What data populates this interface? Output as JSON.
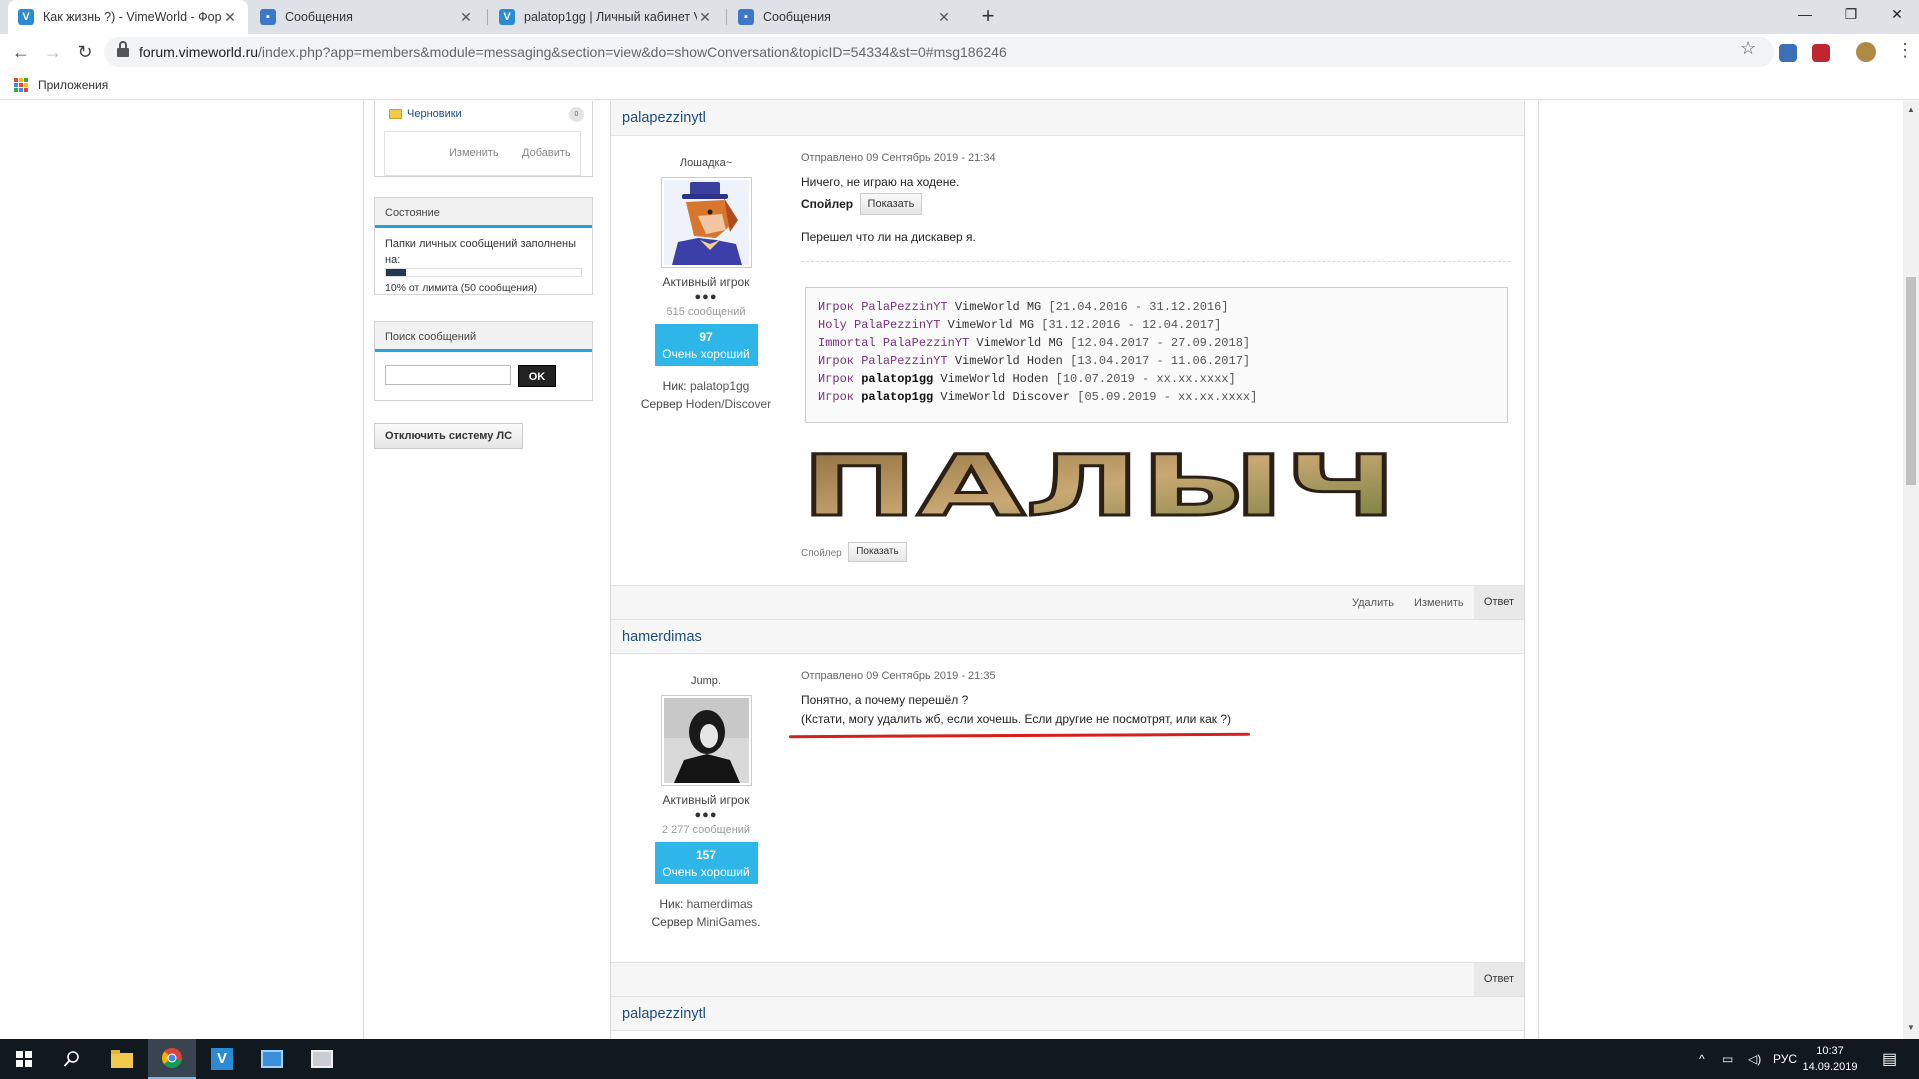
{
  "browser": {
    "tabs": [
      {
        "label": "Как жизнь ?) - VimeWorld - Фор",
        "icon": "vimeworld-icon",
        "active": true
      },
      {
        "label": "Сообщения",
        "icon": "messages-icon",
        "active": false
      },
      {
        "label": "palatop1gg | Личный кабинет V",
        "icon": "vimeworld-icon",
        "active": false
      },
      {
        "label": "Сообщения",
        "icon": "messages-icon",
        "active": false
      }
    ],
    "url_host": "forum.vimeworld.ru",
    "url_path": "/index.php?app=members&module=messaging&section=view&do=showConversation&topicID=54334&st=0#msg186246",
    "bookmark_apps": "Приложения"
  },
  "sidebar": {
    "folder_drafts": "Черновики",
    "folder_drafts_count": "0",
    "edit_link": "Изменить",
    "add_link": "Добавить",
    "status_title": "Состояние",
    "quota_text": "Папки личных сообщений заполнены на:",
    "quota_percent": 10,
    "quota_sub": "10% от лимита (50 сообщения)",
    "search_title": "Поиск сообщений",
    "search_button": "OK",
    "disable_button": "Отключить систему ЛС"
  },
  "posts": [
    {
      "author": "palapezzinytl",
      "user_title": "Лошадка~",
      "rank": "Активный игрок",
      "pips": "●●●",
      "posts_count": "515 сообщений",
      "rep_value": "97",
      "rep_label": "Очень хороший",
      "nick_label": "Ник:",
      "nick": "palatop1gg",
      "server_label": "Сервер",
      "server": "Hoden/Discover",
      "date": "Отправлено 09 Сентябрь 2019 - 21:34",
      "text1": "Ничего, не играю на ходене.",
      "spoiler_label": "Спойлер",
      "spoiler_button": "Показать",
      "text2": "Перешел что ли на дискавер я.",
      "signature_lines": [
        [
          "Игрок ",
          "PalaPezzinYT",
          " VimeWorld MG ",
          "[21.04.2016 - 31.12.2016]"
        ],
        [
          "Holy ",
          "PalaPezzinYT",
          " VimeWorld MG ",
          "[31.12.2016 - 12.04.2017]"
        ],
        [
          "Immortal ",
          "PalaPezzinYT",
          " VimeWorld MG ",
          "[12.04.2017 - 27.09.2018]"
        ],
        [
          "Игрок ",
          "PalaPezzinYT",
          " VimeWorld Hoden ",
          "[13.04.2017 - 11.06.2017]"
        ],
        [
          "Игрок ",
          "palatop1gg",
          " VimeWorld Hoden ",
          "[10.07.2019 - xx.xx.xxxx]"
        ],
        [
          "Игрок ",
          "palatop1gg",
          " VimeWorld Discover ",
          "[05.09.2019 - xx.xx.xxxx]"
        ]
      ],
      "banner_text": "ПАЛЫЧ",
      "sig_spoiler_label": "Спойлер",
      "sig_spoiler_button": "Показать",
      "footer_delete": "Удалить",
      "footer_edit": "Изменить",
      "footer_reply": "Ответ"
    },
    {
      "author": "hamerdimas",
      "user_title": "Jump.",
      "rank": "Активный игрок",
      "pips": "●●●",
      "posts_count": "2 277 сообщений",
      "rep_value": "157",
      "rep_label": "Очень хороший",
      "nick_label": "Ник:",
      "nick": "hamerdimas",
      "server_label": "Сервер",
      "server": "MiniGames.",
      "date": "Отправлено 09 Сентябрь 2019 - 21:35",
      "text1": "Понятно, а почему перешёл ?",
      "text2": "(Кстати, могу удалить жб, если хочешь. Если другие не посмотрят, или как ?)",
      "footer_reply": "Ответ"
    },
    {
      "author": "palapezzinytl"
    }
  ],
  "taskbar": {
    "language": "РУС",
    "time": "10:37",
    "date": "14.09.2019"
  }
}
